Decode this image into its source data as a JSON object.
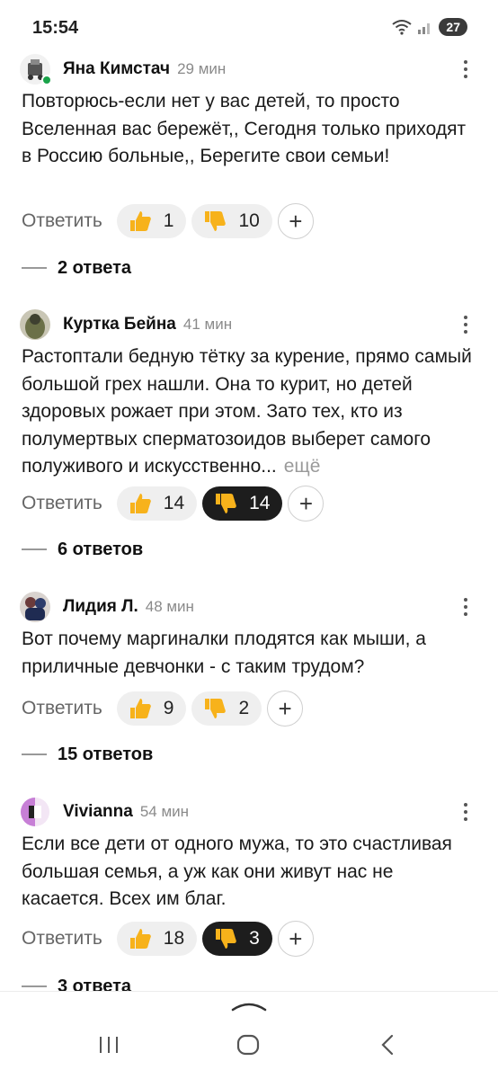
{
  "status_bar": {
    "time": "15:54",
    "battery": "27"
  },
  "comments": [
    {
      "author": "Яна Кимстач",
      "time": "29 мин",
      "text": "Повторюсь-если нет у вас детей, то просто Вселенная вас бережёт,, Сегодня только приходят в Россию больные,, Берегите свои семьи!",
      "reply_label": "Ответить",
      "likes": "1",
      "dislikes": "10",
      "dislike_active": false,
      "replies": "2 ответа"
    },
    {
      "author": "Куртка Бейна",
      "time": "41 мин",
      "text": "Растоптали бедную тётку за курение, прямо самый большой грех нашли. Она то курит, но детей здоровых рожает при этом. Зато тех, кто из полумертвых сперматозоидов выберет самого полуживого и искусственно...",
      "more_label": "ещё",
      "reply_label": "Ответить",
      "likes": "14",
      "dislikes": "14",
      "dislike_active": true,
      "replies": "6 ответов"
    },
    {
      "author": "Лидия Л.",
      "time": "48 мин",
      "text": "Вот почему маргиналки плодятся как мыши, а приличные девчонки - с таким трудом?",
      "reply_label": "Ответить",
      "likes": "9",
      "dislikes": "2",
      "dislike_active": false,
      "replies": "15 ответов"
    },
    {
      "author": "Vivianna",
      "time": "54 мин",
      "text": "Если все дети от одного мужа, то это счастливая большая семья, а уж как они живут нас не касается. Всех им благ.",
      "reply_label": "Ответить",
      "likes": "18",
      "dislikes": "3",
      "dislike_active": true,
      "replies": "3 ответа"
    }
  ],
  "icons": {
    "like": "thumbs-up-icon",
    "dislike": "thumbs-down-icon",
    "add_reaction": "plus-icon",
    "more": "more-vertical-icon"
  },
  "colors": {
    "active_pill": "#1d1d1d",
    "pill": "#efefef",
    "online": "#1aa34a",
    "emoji": "#f7b21b"
  }
}
